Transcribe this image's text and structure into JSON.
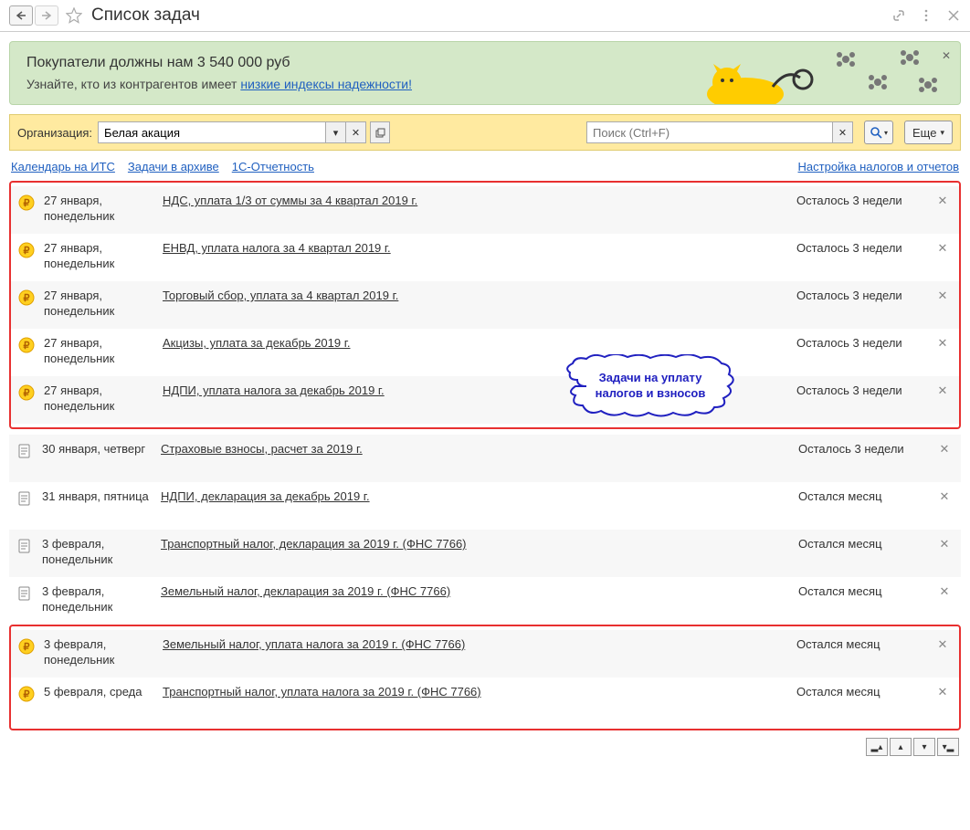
{
  "title": "Список задач",
  "banner": {
    "title": "Покупатели должны нам 3 540 000 руб",
    "subtitle_prefix": "Узнайте, кто из контрагентов имеет ",
    "link": "низкие индексы надежности!"
  },
  "toolbar": {
    "org_label": "Организация:",
    "org_value": "Белая акация",
    "search_placeholder": "Поиск (Ctrl+F)",
    "more_label": "Еще"
  },
  "links": {
    "calendar": "Календарь на ИТС",
    "archive": "Задачи в архиве",
    "reporting": "1С-Отчетность",
    "settings": "Настройка налогов и отчетов"
  },
  "callout": {
    "line1": "Задачи на уплату",
    "line2": "налогов и взносов"
  },
  "groups": [
    {
      "boxed": true,
      "tasks": [
        {
          "icon": "ruble",
          "date": "27 января, понедельник",
          "name": "НДС, уплата 1/3 от суммы за 4 квартал 2019 г.",
          "remain": "Осталось 3 недели"
        },
        {
          "icon": "ruble",
          "date": "27 января, понедельник",
          "name": "ЕНВД, уплата налога за 4 квартал 2019 г.",
          "remain": "Осталось 3 недели"
        },
        {
          "icon": "ruble",
          "date": "27 января, понедельник",
          "name": "Торговый сбор, уплата за 4 квартал 2019 г.",
          "remain": "Осталось 3 недели"
        },
        {
          "icon": "ruble",
          "date": "27 января, понедельник",
          "name": "Акцизы, уплата за декабрь 2019 г.",
          "remain": "Осталось 3 недели"
        },
        {
          "icon": "ruble",
          "date": "27 января, понедельник",
          "name": "НДПИ, уплата налога за декабрь 2019 г.",
          "remain": "Осталось 3 недели"
        }
      ]
    },
    {
      "boxed": false,
      "tasks": [
        {
          "icon": "doc",
          "date": "30 января, четверг",
          "name": "Страховые взносы, расчет за 2019 г.",
          "remain": "Осталось 3 недели"
        },
        {
          "icon": "doc",
          "date": "31 января, пятница",
          "name": "НДПИ, декларация за декабрь 2019 г.",
          "remain": "Остался месяц"
        },
        {
          "icon": "doc",
          "date": "3 февраля, понедельник",
          "name": "Транспортный налог, декларация за 2019 г. (ФНС 7766)",
          "remain": "Остался месяц"
        },
        {
          "icon": "doc",
          "date": "3 февраля, понедельник",
          "name": "Земельный налог, декларация за 2019 г. (ФНС 7766)",
          "remain": "Остался месяц"
        }
      ]
    },
    {
      "boxed": true,
      "tasks": [
        {
          "icon": "ruble",
          "date": "3 февраля, понедельник",
          "name": "Земельный налог, уплата налога за 2019 г. (ФНС 7766)",
          "remain": "Остался месяц"
        },
        {
          "icon": "ruble",
          "date": "5 февраля, среда",
          "name": "Транспортный налог, уплата налога за 2019 г. (ФНС 7766)",
          "remain": "Остался месяц"
        }
      ]
    }
  ]
}
